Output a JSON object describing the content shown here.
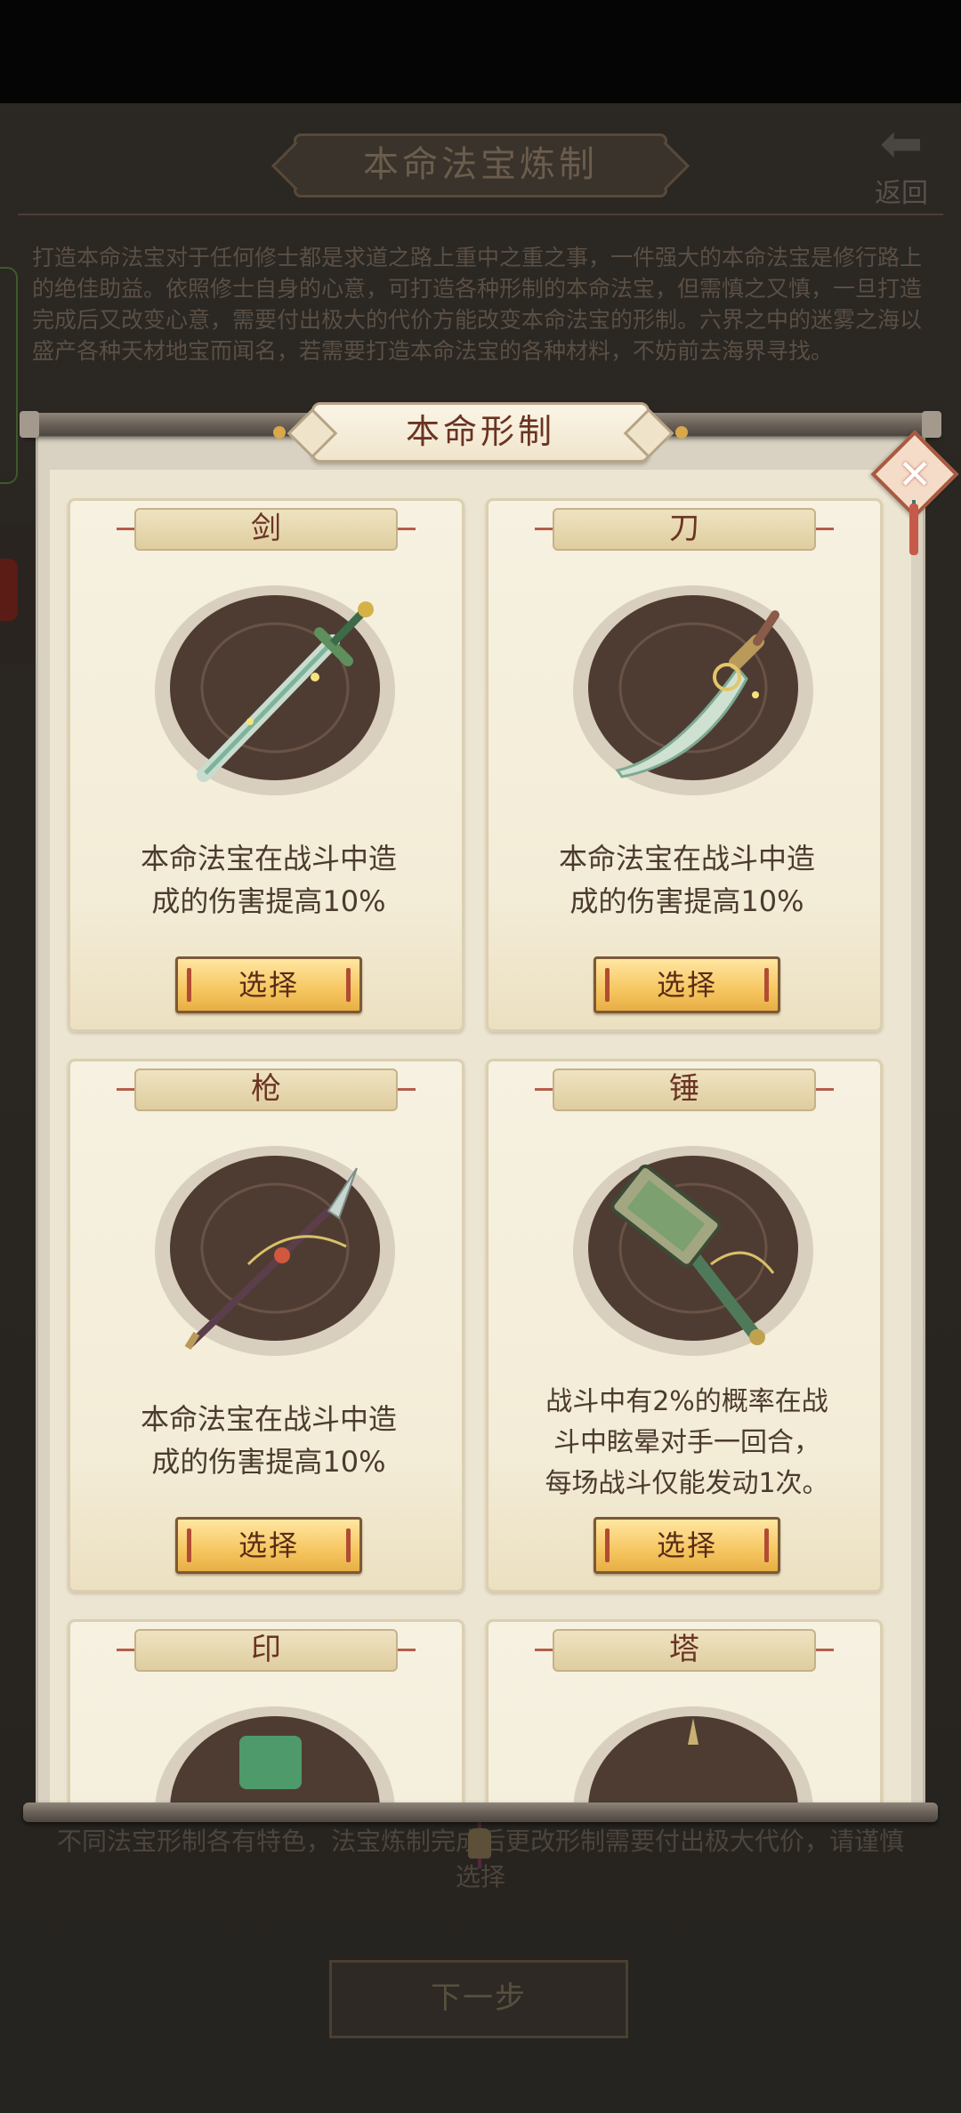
{
  "background_page": {
    "title": "本命法宝炼制",
    "back_label": "返回",
    "intro": "打造本命法宝对于任何修士都是求道之路上重中之重之事，一件强大的本命法宝是修行路上的绝佳助益。依照修士自身的心意，可打造各种形制的本命法宝，但需慎之又慎，一旦打造完成后又改变心意，需要付出极大的代价方能改变本命法宝的形制。六界之中的迷雾之海以盛产各种天材地宝而闻名，若需要打造本命法宝的各种材料，不妨前去海界寻找。",
    "bottom_note": "不同法宝形制各有特色，法宝炼制完成后更改形制需要付出极大代价，请谨慎选择",
    "next_label": "下一步"
  },
  "modal": {
    "title": "本命形制",
    "close_icon": "close-icon",
    "cards": [
      {
        "name": "剑",
        "icon": "sword-icon",
        "desc_line1": "本命法宝在战斗中造",
        "desc_line2": "成的伤害提高10%",
        "desc_line3": "",
        "button": "选择"
      },
      {
        "name": "刀",
        "icon": "saber-icon",
        "desc_line1": "本命法宝在战斗中造",
        "desc_line2": "成的伤害提高10%",
        "desc_line3": "",
        "button": "选择"
      },
      {
        "name": "枪",
        "icon": "spear-icon",
        "desc_line1": "本命法宝在战斗中造",
        "desc_line2": "成的伤害提高10%",
        "desc_line3": "",
        "button": "选择"
      },
      {
        "name": "锤",
        "icon": "hammer-icon",
        "desc_line1": "战斗中有2%的概率在战",
        "desc_line2": "斗中眩晕对手一回合，",
        "desc_line3": "每场战斗仅能发动1次。",
        "button": "选择"
      },
      {
        "name": "印",
        "icon": "seal-icon"
      },
      {
        "name": "塔",
        "icon": "pagoda-icon"
      }
    ]
  }
}
